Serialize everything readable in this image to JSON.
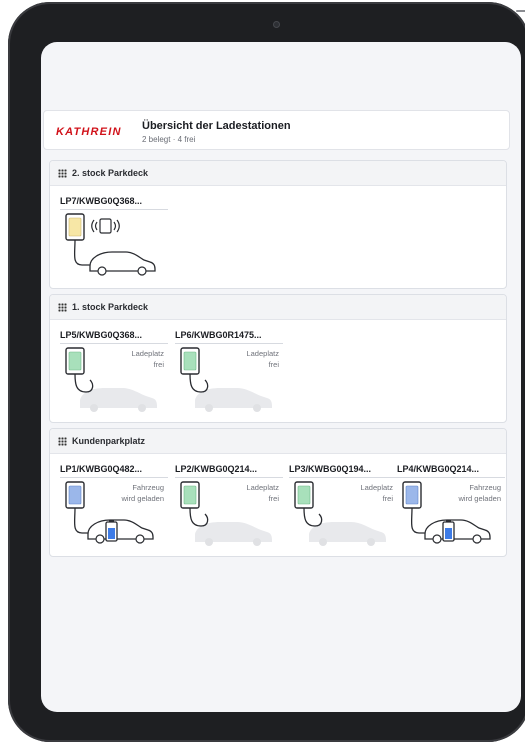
{
  "header": {
    "brand": "KATHREIN",
    "title": "Übersicht der Ladestationen",
    "subtitle": "2 belegt · 4 frei"
  },
  "sections": [
    {
      "title": "2. stock Parkdeck",
      "stations": [
        {
          "name": "LP7/KWBG0Q368...",
          "state": "waiting",
          "status": ""
        }
      ]
    },
    {
      "title": "1. stock Parkdeck",
      "stations": [
        {
          "name": "LP5/KWBG0Q368...",
          "state": "free",
          "status": "Ladeplatz frei"
        },
        {
          "name": "LP6/KWBG0R1475...",
          "state": "free",
          "status": "Ladeplatz frei"
        }
      ]
    },
    {
      "title": "Kundenparkplatz",
      "stations": [
        {
          "name": "LP1/KWBG0Q482...",
          "state": "charging",
          "status": "Fahrzeug wird geladen"
        },
        {
          "name": "LP2/KWBG0Q214...",
          "state": "free",
          "status": "Ladeplatz frei"
        },
        {
          "name": "LP3/KWBG0Q194...",
          "state": "free",
          "status": "Ladeplatz frei"
        },
        {
          "name": "LP4/KWBG0Q214...",
          "state": "charging",
          "status": "Fahrzeug wird geladen"
        }
      ]
    }
  ],
  "colors": {
    "waiting": "#f7e7a6",
    "free": "#a8e0bb",
    "charging": "#9bb7ea",
    "brand": "#d1121a"
  }
}
